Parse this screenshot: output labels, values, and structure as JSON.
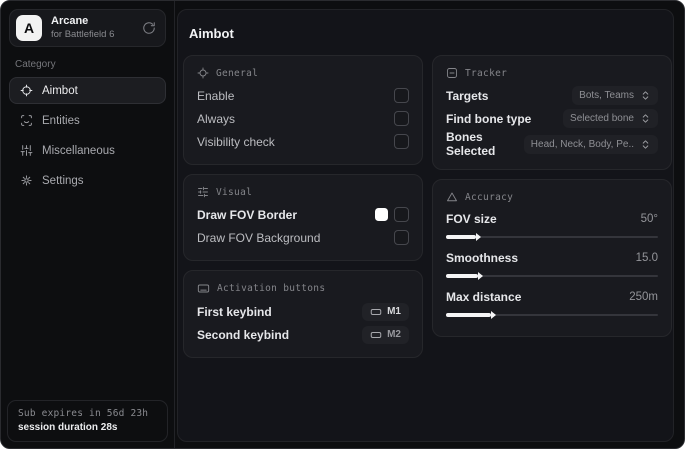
{
  "app_header": {
    "logo_letter": "A",
    "name": "Arcane",
    "subtitle": "for Battlefield 6"
  },
  "sidebar": {
    "category_label": "Category",
    "items": [
      {
        "label": "Aimbot"
      },
      {
        "label": "Entities"
      },
      {
        "label": "Miscellaneous"
      },
      {
        "label": "Settings"
      }
    ],
    "status": {
      "sub_expiry": "Sub expires in 56d 23h",
      "session_duration": "session duration 28s"
    }
  },
  "page": {
    "title": "Aimbot"
  },
  "general": {
    "title": "General",
    "rows": [
      {
        "label": "Enable",
        "checked": false
      },
      {
        "label": "Always",
        "checked": false
      },
      {
        "label": "Visibility check",
        "checked": false
      }
    ]
  },
  "visual": {
    "title": "Visual",
    "rows": [
      {
        "label": "Draw FOV Border",
        "swatch": "#ffffff",
        "checked": false
      },
      {
        "label": "Draw FOV Background",
        "checked": false
      }
    ]
  },
  "activation": {
    "title": "Activation buttons",
    "rows": [
      {
        "label": "First keybind",
        "key": "M1"
      },
      {
        "label": "Second keybind",
        "key": "M2"
      }
    ]
  },
  "tracker": {
    "title": "Tracker",
    "rows": [
      {
        "label": "Targets",
        "value": "Bots, Teams"
      },
      {
        "label": "Find bone type",
        "value": "Selected bone"
      },
      {
        "label": "Bones Selected",
        "value": "Head, Neck, Body, Pe.."
      }
    ]
  },
  "accuracy": {
    "title": "Accuracy",
    "sliders": [
      {
        "label": "FOV size",
        "value": "50°",
        "fill": "14%"
      },
      {
        "label": "Smoothness",
        "value": "15.0",
        "fill": "15%"
      },
      {
        "label": "Max distance",
        "value": "250m",
        "fill": "21%"
      }
    ]
  },
  "colors": {
    "accent": "#f5f5f6",
    "panel_bg": "#131419",
    "card_bg": "#191a1f"
  }
}
